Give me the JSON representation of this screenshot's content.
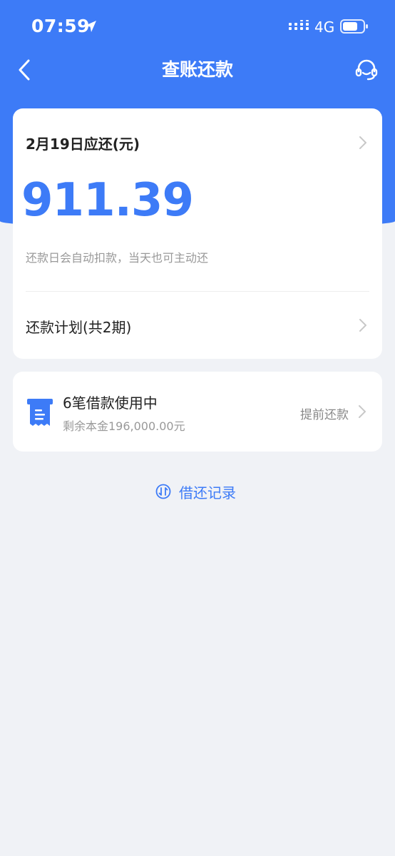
{
  "status_bar": {
    "time": "07:59",
    "network": "4G"
  },
  "header": {
    "title": "查账还款"
  },
  "due_card": {
    "label": "2月19日应还(元)",
    "amount": "911.39",
    "note": "还款日会自动扣款，当天也可主动还",
    "plan_label": "还款计划(共2期)"
  },
  "loan_card": {
    "title": "6笔借款使用中",
    "subtitle": "剩余本金196,000.00元",
    "prepay_label": "提前还款"
  },
  "history": {
    "label": "借还记录"
  },
  "colors": {
    "accent": "#3d7bf7",
    "background": "#f0f2f6",
    "card": "#ffffff"
  },
  "icons": [
    "location-arrow-icon",
    "signal-icon",
    "battery-icon",
    "back-icon",
    "customer-service-icon",
    "chevron-right-icon",
    "loan-document-icon",
    "exchange-icon"
  ]
}
